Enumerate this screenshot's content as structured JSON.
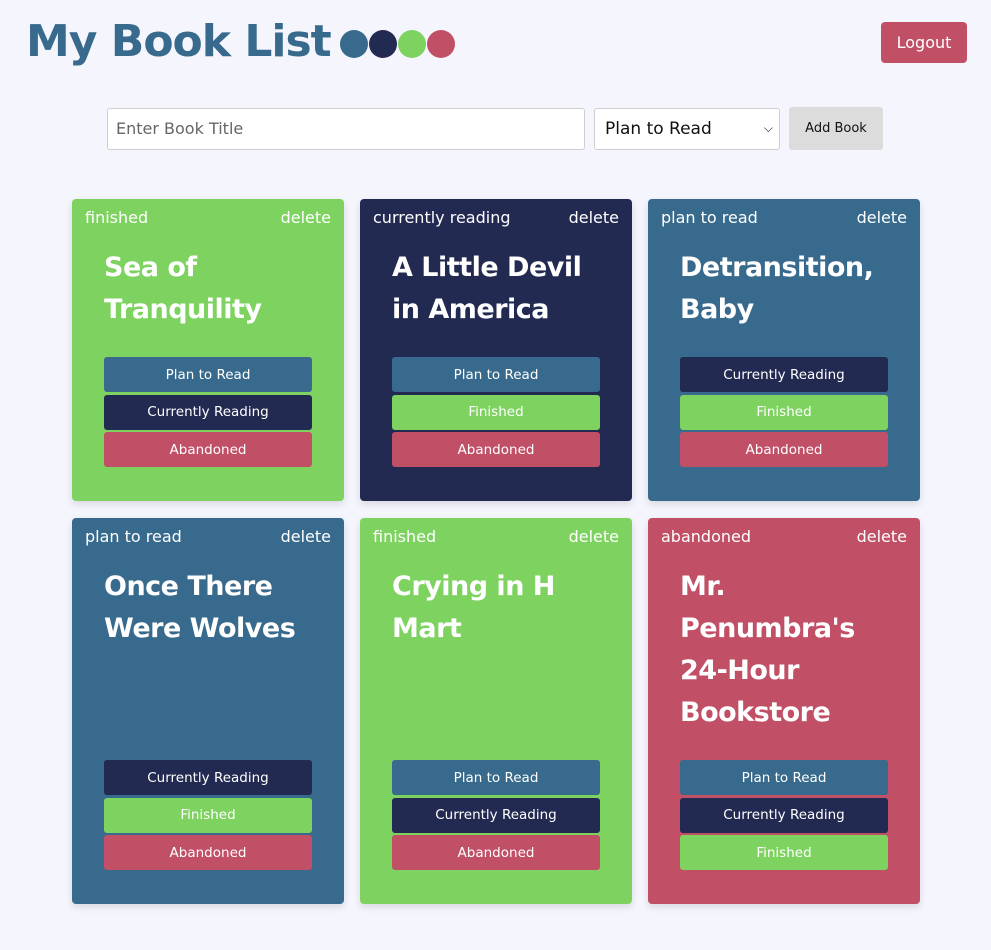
{
  "app": {
    "title": "My Book List",
    "palette": [
      "#376a8c",
      "#232a52",
      "#7ed360",
      "#c14f66"
    ]
  },
  "header": {
    "logout_label": "Logout"
  },
  "form": {
    "placeholder": "Enter Book Title",
    "value": "",
    "selected_status": "Plan to Read",
    "add_label": "Add Book"
  },
  "delete_label": "delete",
  "cards": [
    {
      "status": "finished",
      "title": "Sea of Tranquility",
      "color": "#7ed360",
      "actions": [
        {
          "label": "Plan to Read",
          "color": "#376a8c"
        },
        {
          "label": "Currently Reading",
          "color": "#232a52"
        },
        {
          "label": "Abandoned",
          "color": "#c14f66"
        }
      ]
    },
    {
      "status": "currently reading",
      "title": "A Little Devil in America",
      "color": "#232a52",
      "actions": [
        {
          "label": "Plan to Read",
          "color": "#376a8c"
        },
        {
          "label": "Finished",
          "color": "#7ed360"
        },
        {
          "label": "Abandoned",
          "color": "#c14f66"
        }
      ]
    },
    {
      "status": "plan to read",
      "title": "Detransition, Baby",
      "color": "#376a8c",
      "actions": [
        {
          "label": "Currently Reading",
          "color": "#232a52"
        },
        {
          "label": "Finished",
          "color": "#7ed360"
        },
        {
          "label": "Abandoned",
          "color": "#c14f66"
        }
      ]
    },
    {
      "status": "plan to read",
      "title": "Once There Were Wolves",
      "color": "#376a8c",
      "actions": [
        {
          "label": "Currently Reading",
          "color": "#232a52"
        },
        {
          "label": "Finished",
          "color": "#7ed360"
        },
        {
          "label": "Abandoned",
          "color": "#c14f66"
        }
      ]
    },
    {
      "status": "finished",
      "title": "Crying in H Mart",
      "color": "#7ed360",
      "actions": [
        {
          "label": "Plan to Read",
          "color": "#376a8c"
        },
        {
          "label": "Currently Reading",
          "color": "#232a52"
        },
        {
          "label": "Abandoned",
          "color": "#c14f66"
        }
      ]
    },
    {
      "status": "abandoned",
      "title": "Mr. Penumbra's 24-Hour Bookstore",
      "color": "#c14f66",
      "actions": [
        {
          "label": "Plan to Read",
          "color": "#376a8c"
        },
        {
          "label": "Currently Reading",
          "color": "#232a52"
        },
        {
          "label": "Finished",
          "color": "#7ed360"
        }
      ]
    }
  ]
}
